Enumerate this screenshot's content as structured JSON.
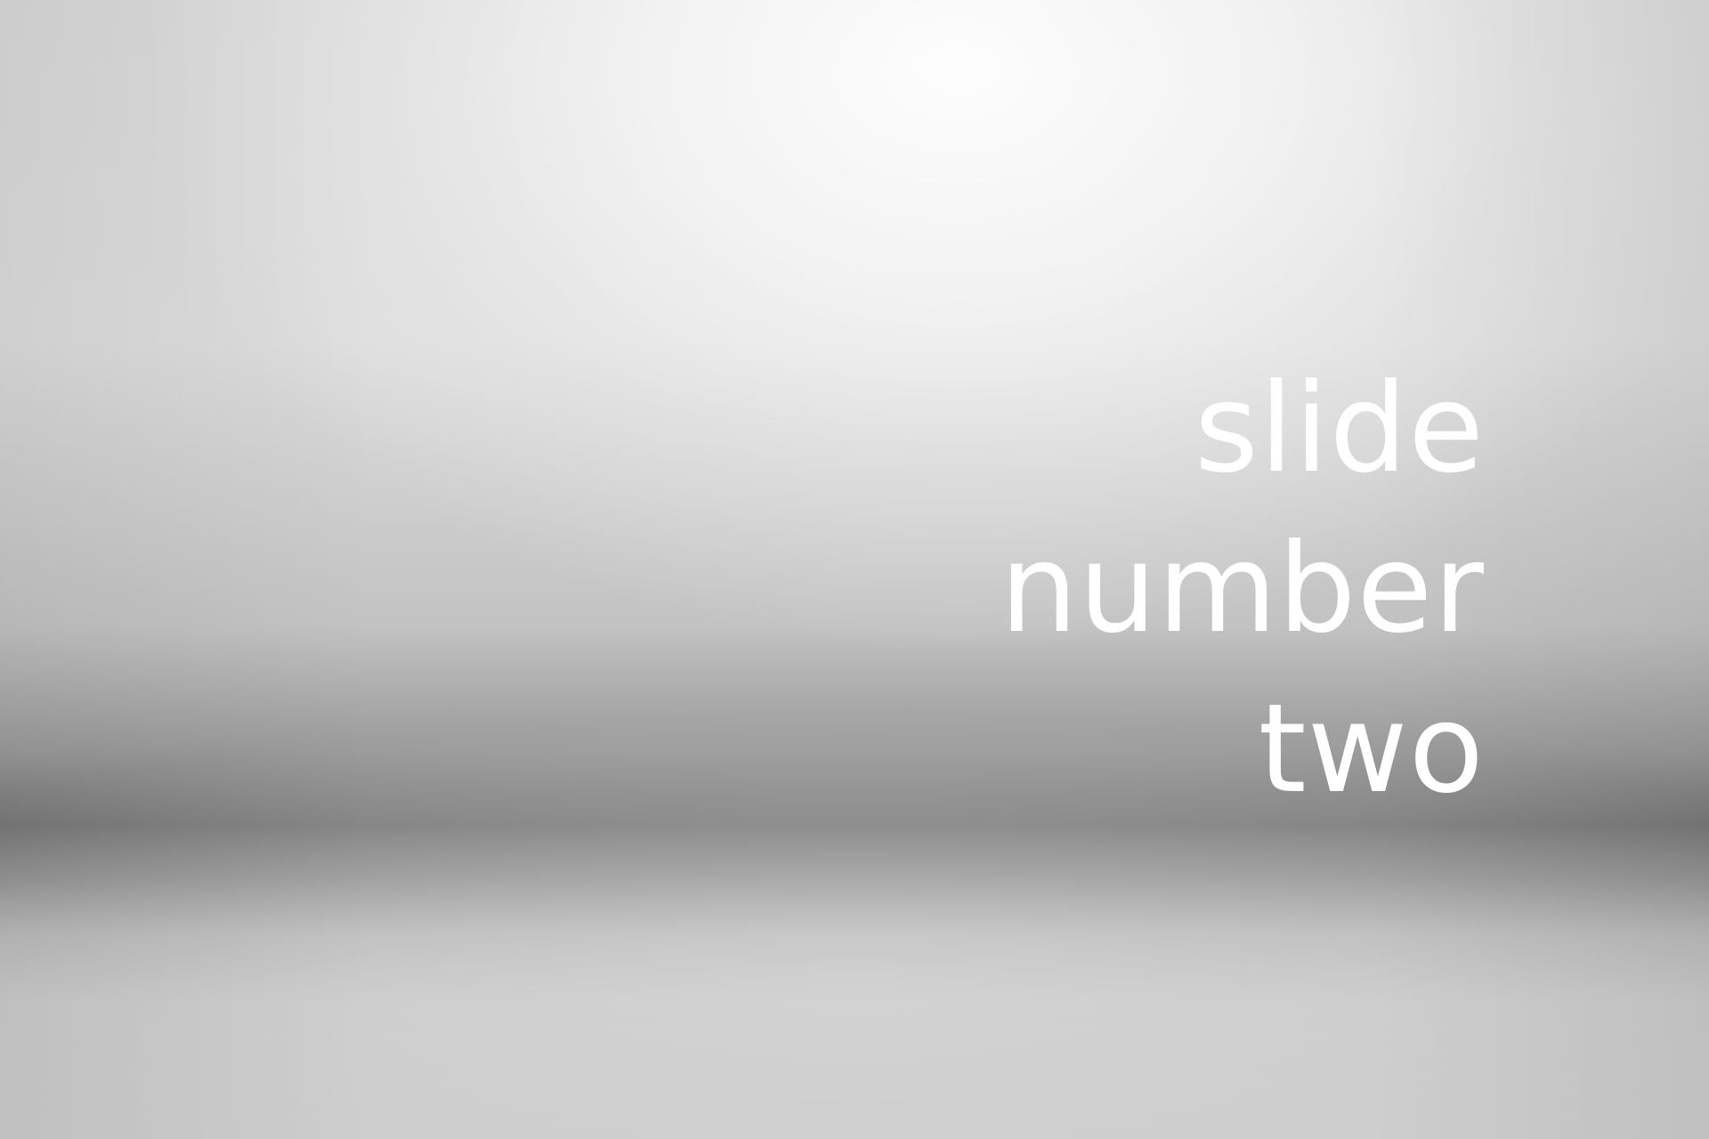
{
  "slide": {
    "title_lines": [
      "slide",
      "number",
      "two"
    ],
    "text_color": "#ffffff"
  }
}
